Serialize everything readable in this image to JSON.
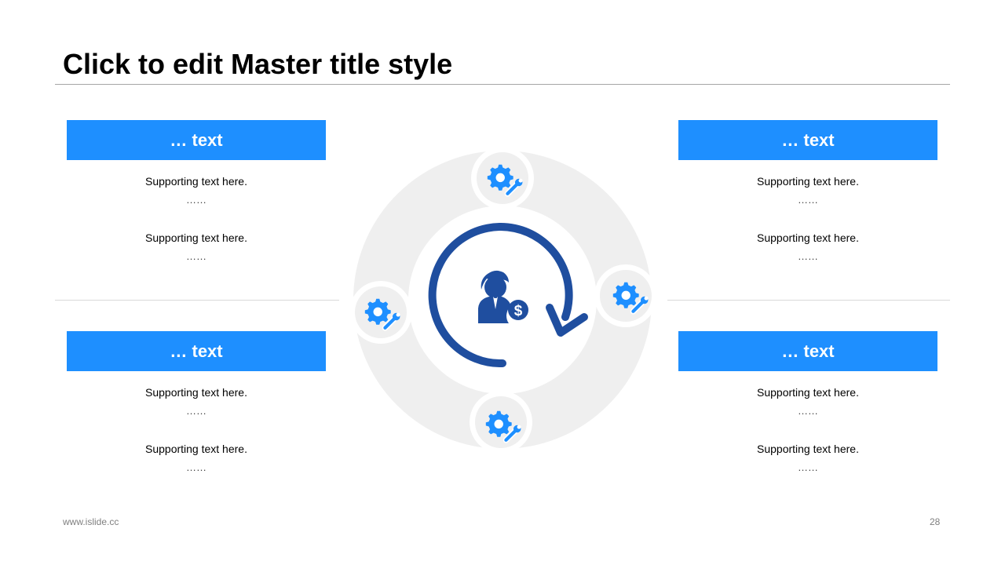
{
  "slide": {
    "title": "Click to edit Master title style",
    "footer_url": "www.islide.cc",
    "page_number": "28"
  },
  "panels": [
    {
      "header": "… text",
      "line1": "Supporting text here.",
      "dots1": "……",
      "line2": "Supporting text here.",
      "dots2": "……"
    },
    {
      "header": "… text",
      "line1": "Supporting text here.",
      "dots1": "……",
      "line2": "Supporting text here.",
      "dots2": "……"
    },
    {
      "header": "… text",
      "line1": "Supporting text here.",
      "dots1": "……",
      "line2": "Supporting text here.",
      "dots2": "……"
    },
    {
      "header": "… text",
      "line1": "Supporting text here.",
      "dots1": "……",
      "line2": "Supporting text here.",
      "dots2": "……"
    }
  ],
  "colors": {
    "accent": "#1e8fff",
    "dark_blue": "#1f4e9f",
    "ring_gray": "#efefef"
  },
  "icons": {
    "center": "businessman-dollar-icon",
    "nodes": [
      "gear-wrench-icon",
      "gear-wrench-icon",
      "gear-wrench-icon",
      "gear-wrench-icon"
    ]
  }
}
